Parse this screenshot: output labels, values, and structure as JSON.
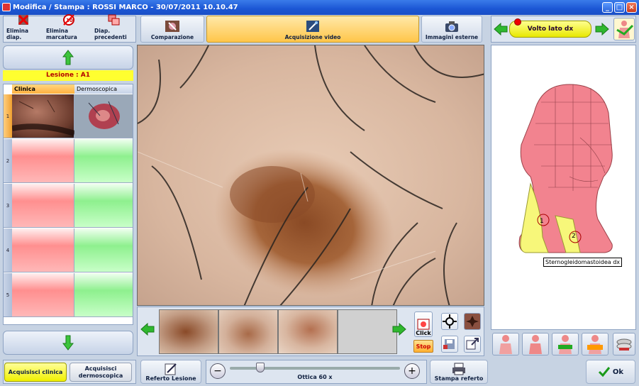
{
  "window": {
    "title": "Modifica / Stampa : ROSSI MARCO  -  30/07/2011 10.10.47",
    "min": "_",
    "max": "□",
    "close": "×"
  },
  "toolbar": {
    "elimina_diap": "Elimina diap.",
    "elimina_marcatura": "Elimina marcatura",
    "diap_precedenti": "Diap. precedenti",
    "comparazione": "Comparazione",
    "acquisizione_video": "Acquisizione video",
    "immagini_esterne": "Immagini esterne",
    "view_selector": "Volto lato dx"
  },
  "lesion": {
    "label": "Lesione : A1"
  },
  "grid": {
    "col_clinica": "Clinica",
    "col_dermoscopica": "Dermoscopica",
    "rows": [
      "1",
      "2",
      "3",
      "4",
      "5"
    ]
  },
  "controls": {
    "click": "Click",
    "stop": "Stop"
  },
  "body_map": {
    "tooltip": "Sternogleidomastoidea dx",
    "marker_1": "1",
    "marker_2": "2"
  },
  "bottom": {
    "acquisisci_clinica": "Acquisisci clinica",
    "acquisisci_dermoscopica": "Acquisisci dermoscopica",
    "referto_lesione": "Referto Lesione",
    "ottica": "Ottica 60 x",
    "stampa_referto": "Stampa referto",
    "ok": "Ok",
    "zoom_minus": "−",
    "zoom_plus": "+"
  },
  "colors": {
    "accent_yellow": "#ffff30",
    "lesion_red": "#b30000",
    "active_tab": "#ffc64a"
  }
}
